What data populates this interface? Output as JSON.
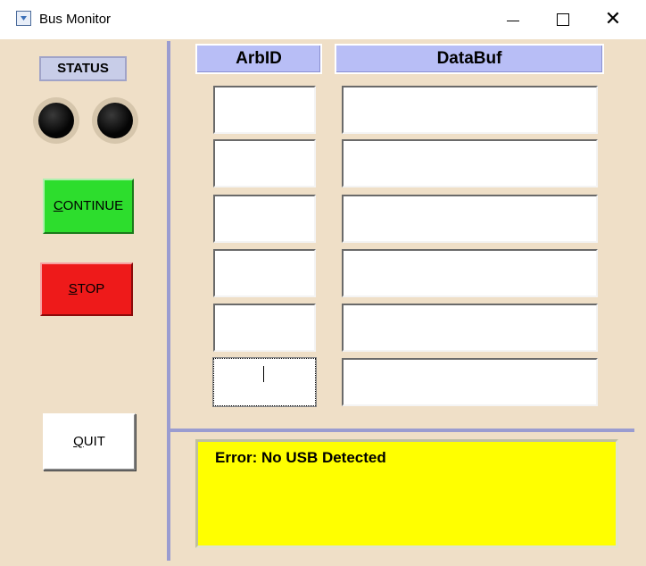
{
  "window": {
    "title": "Bus Monitor",
    "icon": "app-window-icon",
    "controls": [
      "minimize-icon",
      "maximize-icon",
      "close-icon"
    ]
  },
  "status": {
    "label": "STATUS",
    "leds": [
      "off",
      "off"
    ]
  },
  "buttons": {
    "continue": {
      "mnemonic": "C",
      "rest": "ONTINUE",
      "color": "#2ddd2d"
    },
    "stop": {
      "mnemonic": "S",
      "rest": "TOP",
      "color": "#ee1a1a"
    },
    "quit": {
      "mnemonic": "Q",
      "rest": "UIT",
      "color": "#ffffff"
    }
  },
  "table": {
    "headers": {
      "arbid": "ArbID",
      "databuf": "DataBuf"
    },
    "rows": [
      {
        "arbid": "",
        "databuf": ""
      },
      {
        "arbid": "",
        "databuf": ""
      },
      {
        "arbid": "",
        "databuf": ""
      },
      {
        "arbid": "",
        "databuf": ""
      },
      {
        "arbid": "",
        "databuf": ""
      },
      {
        "arbid": "",
        "databuf": ""
      }
    ],
    "focused_row": 5
  },
  "error": {
    "message": "Error: No USB Detected",
    "background": "#ffff00"
  },
  "colors": {
    "panel_background": "#efdfc7",
    "header_background": "#b8bef6",
    "divider": "#9a9cd0"
  }
}
